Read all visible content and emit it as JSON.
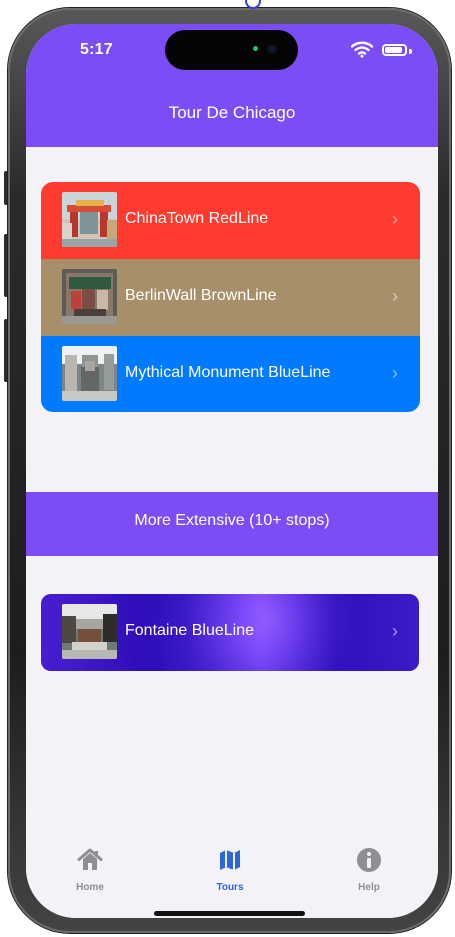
{
  "status_bar": {
    "time": "5:17"
  },
  "app": {
    "title": "Tour De Chicago"
  },
  "tour_lists": {
    "primary_tours": [
      {
        "label": "ChinaTown RedLine",
        "icon": "chevron-right-icon",
        "color": "#ff3b30"
      },
      {
        "label": "BerlinWall BrownLine",
        "icon": "chevron-right-icon",
        "color": "#a78f69"
      },
      {
        "label": "Mythical Monument BlueLine",
        "icon": "chevron-right-icon",
        "color": "#007aff"
      }
    ],
    "section_title": "More Extensive (10+ stops)",
    "extended_tours": [
      {
        "label": "Fontaine BlueLine",
        "icon": "chevron-right-icon",
        "color": "#4a24d6"
      }
    ]
  },
  "tab_bar": {
    "items": [
      {
        "label": "Home",
        "icon": "house-icon",
        "color": "#8e8e93"
      },
      {
        "label": "Tours",
        "icon": "map-icon",
        "color": "#2c66d8"
      },
      {
        "label": "Help",
        "icon": "info-icon",
        "color": "#8e8e93"
      }
    ]
  },
  "colors": {
    "header": "#7a4df6",
    "background": "#f2f2f7",
    "selected_tab": "#2c66d8",
    "unselected_tab": "#8e8e93"
  }
}
